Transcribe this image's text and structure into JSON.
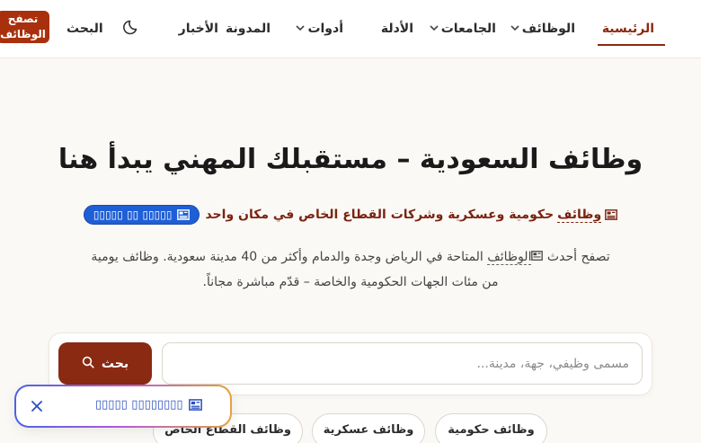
{
  "nav": {
    "items": [
      {
        "label": "الرئيسية",
        "active": true,
        "dropdown": false
      },
      {
        "label": "الوظائف",
        "active": false,
        "dropdown": true
      },
      {
        "label": "الجامعات",
        "active": false,
        "dropdown": true
      },
      {
        "label": "الأدلة",
        "active": false,
        "dropdown": false
      },
      {
        "label": "أدوات",
        "active": false,
        "dropdown": true
      },
      {
        "label": "المدونة",
        "active": false,
        "dropdown": false
      },
      {
        "label": "الأخبار",
        "active": false,
        "dropdown": false
      }
    ],
    "search_label": "البحث",
    "theme_icon": "moon-icon",
    "cta_label": "تصفح الوظائف"
  },
  "hero": {
    "title": "وظائف السعودية – مستقبلك المهني يبدأ هنا",
    "sub_keyword": "وظائف",
    "sub_rest": "حكومية وعسكرية وشركات القطاع الخاص في مكان واحد",
    "badge_label": "▯▯▯▯▯ ▯▯ ▯▯▯▯▯",
    "desc_line1_pre": "تصفح أحدث",
    "desc_keyword": "الوظائف",
    "desc_line1_post": "المتاحة في الرياض وجدة والدمام وأكثر من 40 مدينة سعودية. وظائف يومية",
    "desc_line2": "من مئات الجهات الحكومية والخاصة – قدّم مباشرة مجاناً."
  },
  "search": {
    "placeholder": "مسمى وظيفي، جهة، مدينة...",
    "value": "",
    "button_label": "بحث"
  },
  "chips": [
    "وظائف حكومية",
    "وظائف عسكرية",
    "وظائف القطاع الخاص"
  ],
  "toast": {
    "label": "▯▯▯▯▯▯▯▯ ▯▯▯▯▯"
  },
  "colors": {
    "brand": "#8a2a12",
    "cta": "#a8300c",
    "badge": "#1f5fd6",
    "toast_text": "#2a4fbf",
    "background": "#fbf9f6"
  }
}
